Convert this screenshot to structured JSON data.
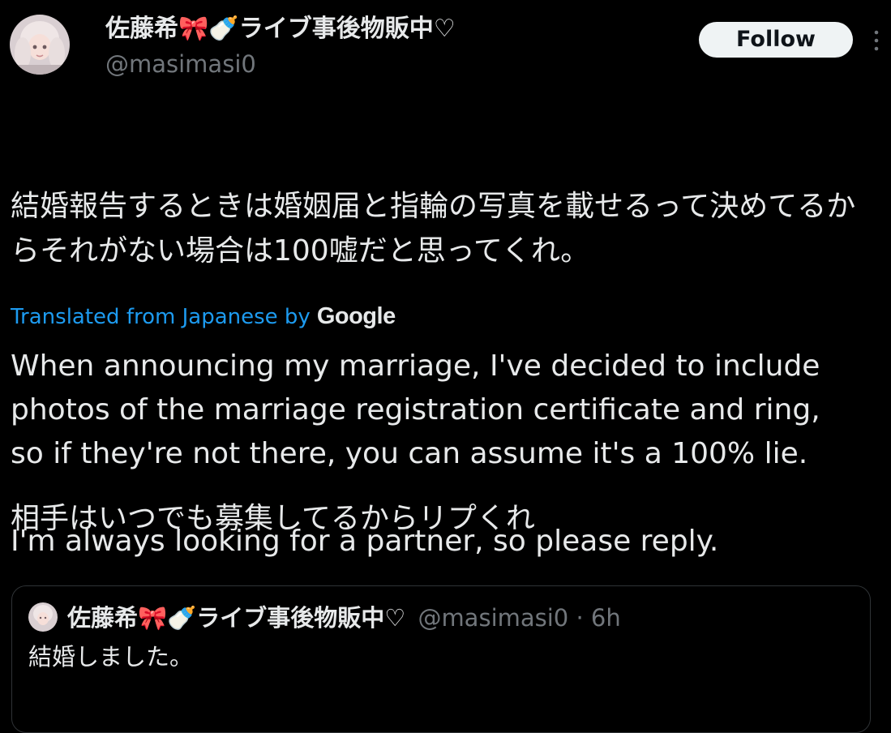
{
  "author": {
    "display_name": "佐藤希🎀🍼ライブ事後物販中♡",
    "handle": "@masimasi0"
  },
  "header": {
    "follow_label": "Follow",
    "more_icon": "more-vertical-icon"
  },
  "post": {
    "paragraphs": [
      "結婚報告するときは婚姻届と指輪の写真を載せるって決めてるからそれがない場合は100嘘だと思ってくれ。",
      "相手はいつでも募集してるからリプくれ"
    ]
  },
  "translation": {
    "notice": "Translated from Japanese by",
    "provider": "Google",
    "lines": [
      "When announcing my marriage, I've decided to include",
      "photos of the marriage registration certificate and ring,",
      "so if they're not there, you can assume it's a 100% lie.",
      "",
      "I'm always looking for a partner, so please reply."
    ]
  },
  "quoted_post": {
    "display_name": "佐藤希🎀🍼ライブ事後物販中♡",
    "meta": "@masimasi0 · 6h",
    "text": "結婚しました。"
  },
  "colors": {
    "background": "#000000",
    "text_primary": "#e7e9ea",
    "text_secondary": "#71767b",
    "link_blue": "#1d9bf0",
    "border": "#2f3336",
    "follow_bg": "#eff3f4"
  }
}
